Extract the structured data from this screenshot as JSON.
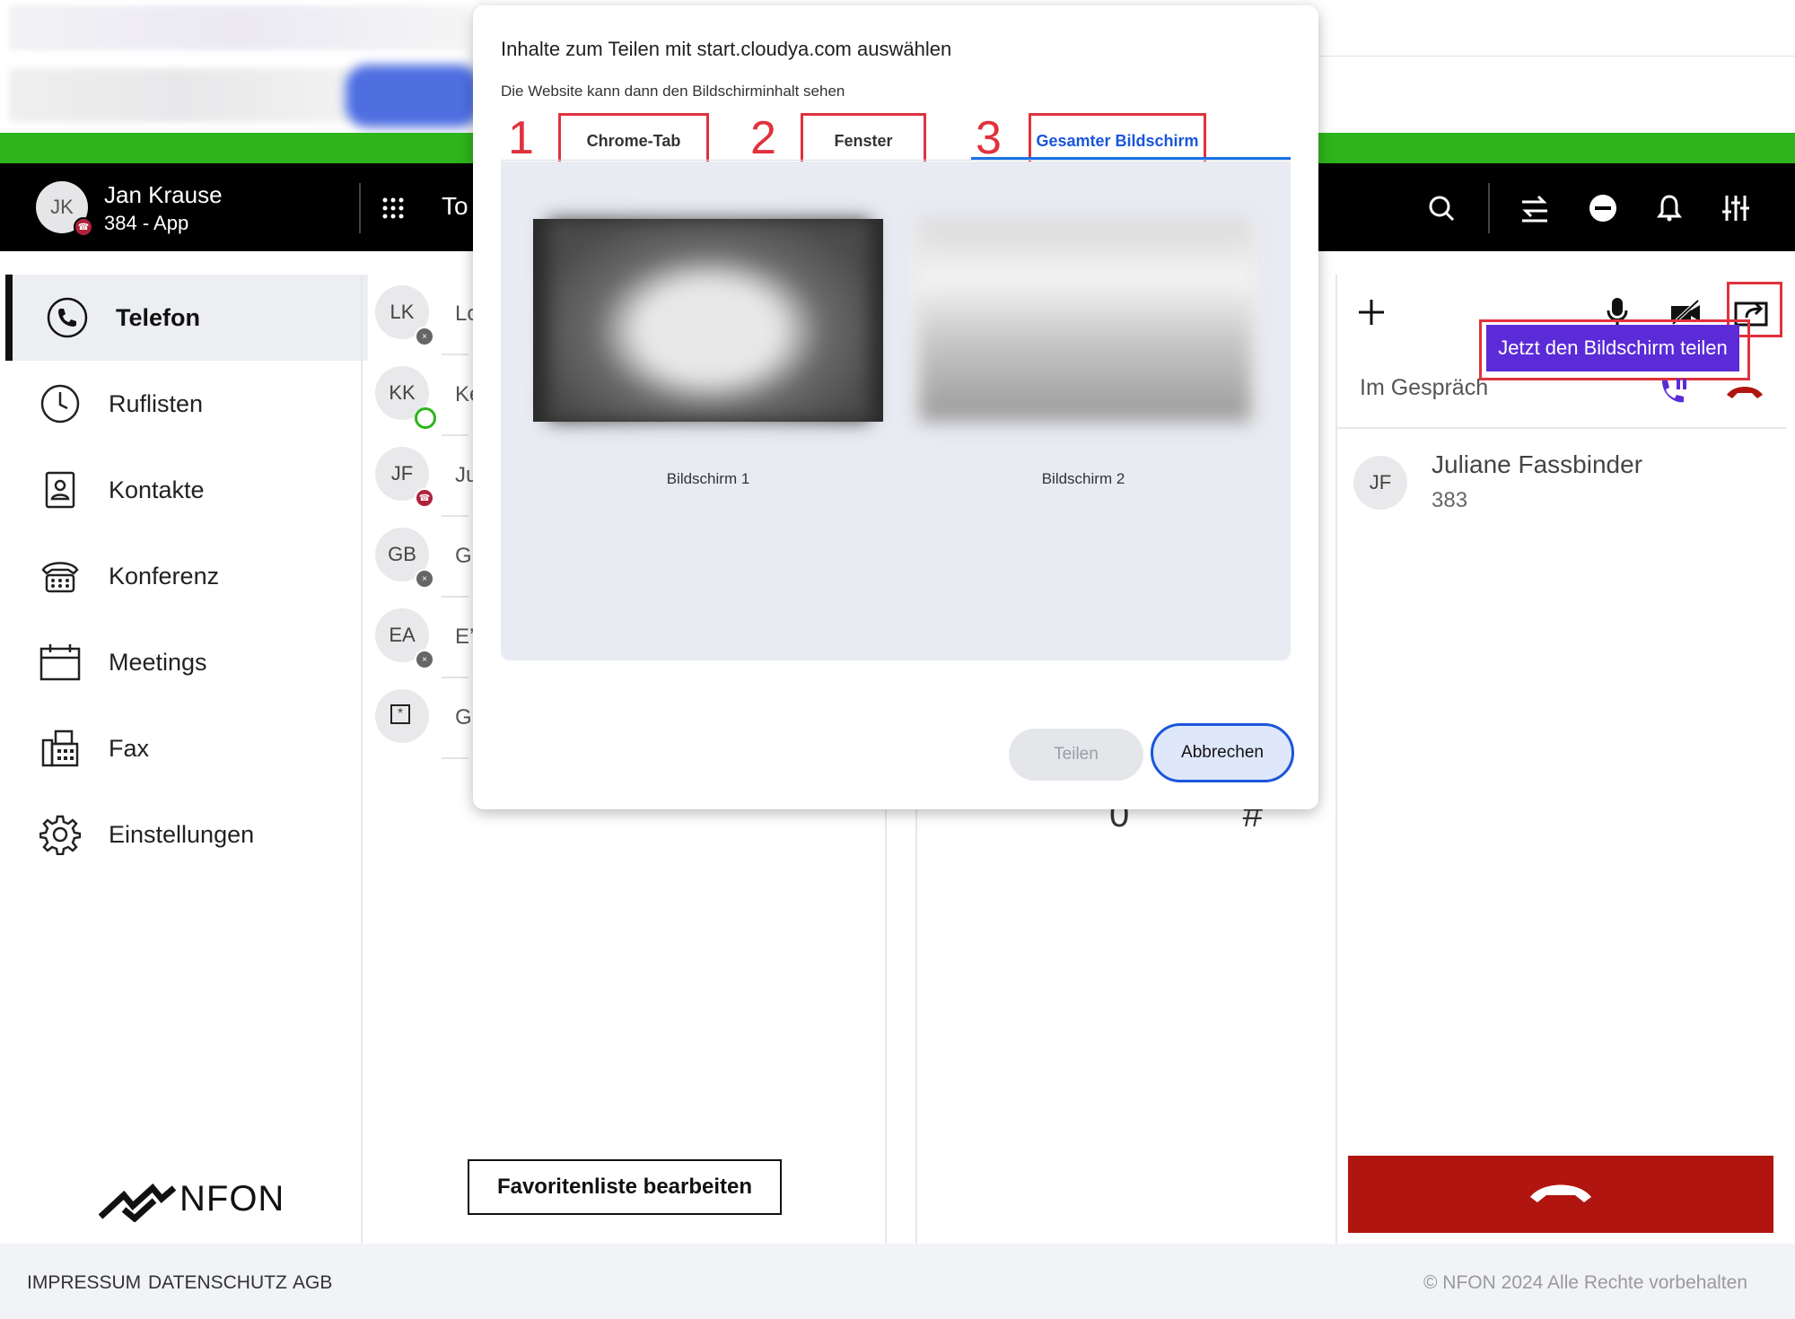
{
  "dialog": {
    "title": "Inhalte zum Teilen mit start.cloudya.com auswählen",
    "subtitle": "Die Website kann dann den Bildschirminhalt sehen",
    "tabs": [
      {
        "number": "1",
        "label": "Chrome-Tab"
      },
      {
        "number": "2",
        "label": "Fenster"
      },
      {
        "number": "3",
        "label": "Gesamter Bildschirm",
        "active": true
      }
    ],
    "screens": [
      {
        "label": "Bildschirm 1"
      },
      {
        "label": "Bildschirm 2"
      }
    ],
    "share_button": "Teilen",
    "cancel_button": "Abbrechen"
  },
  "header": {
    "user_initials": "JK",
    "user_name": "Jan Krause",
    "user_sub": "384 - App",
    "tab_partial": "To",
    "icons": [
      "grid-icon",
      "search-icon",
      "transfer-icon",
      "dnd-icon",
      "bell-icon",
      "settings-sliders-icon"
    ]
  },
  "sidebar": {
    "items": [
      {
        "label": "Telefon",
        "icon": "phone-icon",
        "active": true
      },
      {
        "label": "Ruflisten",
        "icon": "clock-icon"
      },
      {
        "label": "Kontakte",
        "icon": "contact-card-icon"
      },
      {
        "label": "Konferenz",
        "icon": "conference-phone-icon"
      },
      {
        "label": "Meetings",
        "icon": "calendar-icon"
      },
      {
        "label": "Fax",
        "icon": "fax-icon"
      },
      {
        "label": "Einstellungen",
        "icon": "gear-icon"
      }
    ],
    "logo_text": "NFON"
  },
  "contacts": {
    "items": [
      {
        "initials": "LK",
        "name": "Lo",
        "status": "offline"
      },
      {
        "initials": "KK",
        "name": "Ke",
        "status": "available"
      },
      {
        "initials": "JF",
        "name": "Ju",
        "status": "in-call"
      },
      {
        "initials": "GB",
        "name": "G",
        "status": "offline"
      },
      {
        "initials": "EA",
        "name": "E’",
        "status": "offline"
      },
      {
        "initials": "*",
        "name": "G",
        "status": "none"
      }
    ],
    "edit_favorites": "Favoritenliste bearbeiten"
  },
  "dialpad": {
    "keys_visible": [
      "0",
      "#"
    ]
  },
  "call_panel": {
    "tooltip": "Jetzt den Bildschirm teilen",
    "status": "Im Gespräch",
    "caller_initials": "JF",
    "caller_name": "Juliane Fassbinder",
    "caller_number": "383",
    "colors": {
      "hangup": "#b0160f",
      "tooltip": "#5b2bd8",
      "highlight": "#e0323c"
    }
  },
  "footer": {
    "links": [
      "IMPRESSUM",
      "DATENSCHUTZ",
      "AGB"
    ],
    "copyright": "© NFON 2024 Alle Rechte vorbehalten"
  }
}
